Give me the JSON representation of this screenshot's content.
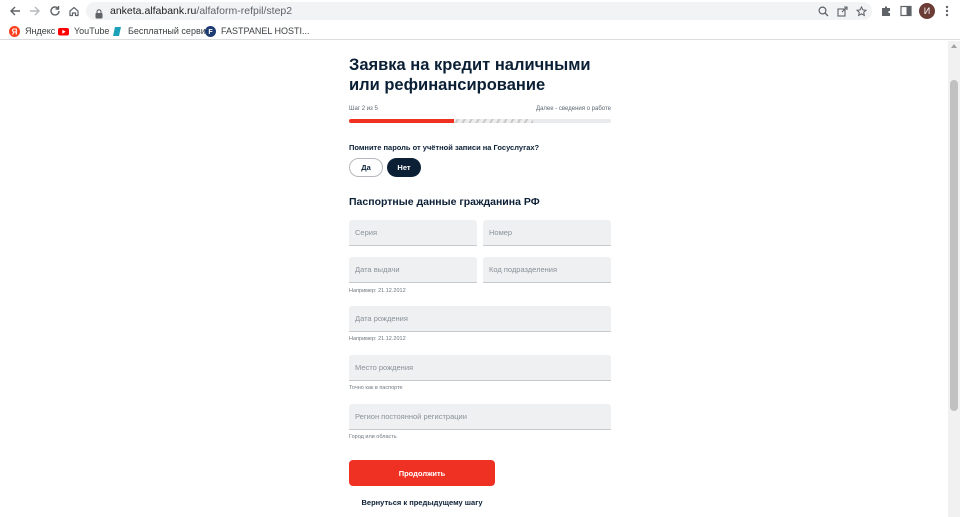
{
  "browser": {
    "url_host": "anketa.alfabank.ru",
    "url_path": "/alfaform-refpil/step2",
    "avatar_letter": "И",
    "bookmarks": [
      {
        "label": "Яндекс",
        "icon": "yandex-icon",
        "color": "#fc3f1d"
      },
      {
        "label": "YouTube",
        "icon": "youtube-icon",
        "color": "#ff0000"
      },
      {
        "label": "Бесплатный серви...",
        "icon": "bookmark-service-icon",
        "color": "#1da1b8"
      },
      {
        "label": "FASTPANEL HOSTI...",
        "icon": "fastpanel-icon",
        "color": "#1f3b73"
      }
    ]
  },
  "form": {
    "title": "Заявка на кредит наличными или рефинансирование",
    "step_label": "Шаг 2 из 5",
    "next_label": "Далее - сведения о работе",
    "progress_fraction": 0.4,
    "question": "Помните пароль от учётной записи на Госуслугах?",
    "answer_yes": "Да",
    "answer_no": "Нет",
    "section_title": "Паспортные данные гражданина РФ",
    "fields": {
      "series": {
        "placeholder": "Серия",
        "value": ""
      },
      "number": {
        "placeholder": "Номер",
        "value": ""
      },
      "issue_date": {
        "placeholder": "Дата выдачи",
        "value": ""
      },
      "division_code": {
        "placeholder": "Код подразделения",
        "value": ""
      },
      "birth_date": {
        "placeholder": "Дата рождения",
        "value": ""
      },
      "birth_place": {
        "placeholder": "Место рождения",
        "value": ""
      },
      "region": {
        "placeholder": "Регион постоянной регистрации",
        "value": ""
      }
    },
    "hints": {
      "issue_date": "Например: 21.12.2012",
      "birth_date": "Например: 21.12.2012",
      "birth_place": "Точно как в паспорте",
      "region": "Город или область"
    },
    "submit_label": "Продолжить",
    "back_label": "Вернуться к предыдущему шагу"
  },
  "colors": {
    "accent": "#ef3124",
    "dark": "#0b1f35",
    "field_bg": "#eef0f2"
  }
}
